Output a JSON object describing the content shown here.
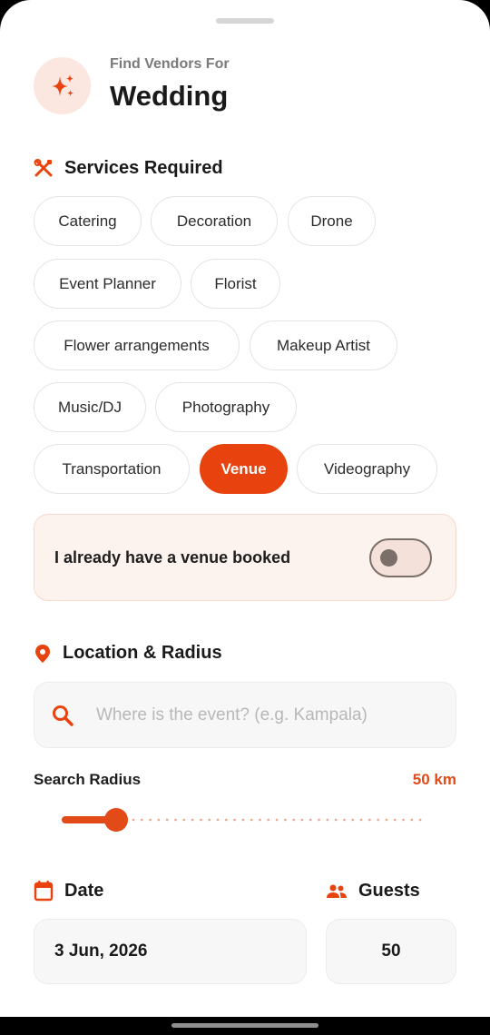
{
  "header": {
    "subtitle": "Find Vendors For",
    "title": "Wedding",
    "icon": "sparkles-icon"
  },
  "services": {
    "heading": "Services Required",
    "icon": "tools-icon",
    "chips": [
      {
        "label": "Catering",
        "selected": false
      },
      {
        "label": "Decoration",
        "selected": false
      },
      {
        "label": "Drone",
        "selected": false
      },
      {
        "label": "Event Planner",
        "selected": false
      },
      {
        "label": "Florist",
        "selected": false
      },
      {
        "label": "Flower arrangements",
        "selected": false
      },
      {
        "label": "Makeup Artist",
        "selected": false
      },
      {
        "label": "Music/DJ",
        "selected": false
      },
      {
        "label": "Photography",
        "selected": false
      },
      {
        "label": "Transportation",
        "selected": false
      },
      {
        "label": "Venue",
        "selected": true
      },
      {
        "label": "Videography",
        "selected": false
      }
    ]
  },
  "venue_toggle": {
    "label": "I already have a venue booked",
    "on": false
  },
  "location": {
    "heading": "Location & Radius",
    "icon": "location-pin-icon",
    "search_icon": "search-icon",
    "value": "",
    "placeholder": "Where is the event? (e.g. Kampala)",
    "radius_label": "Search Radius",
    "radius_value_text": "50 km",
    "radius_fraction": 0.15
  },
  "date": {
    "heading": "Date",
    "icon": "calendar-icon",
    "value": "3 Jun, 2026"
  },
  "guests": {
    "heading": "Guests",
    "icon": "people-icon",
    "value": "50"
  },
  "colors": {
    "accent": "#e8430e",
    "accent_light": "#fdf3ee"
  }
}
